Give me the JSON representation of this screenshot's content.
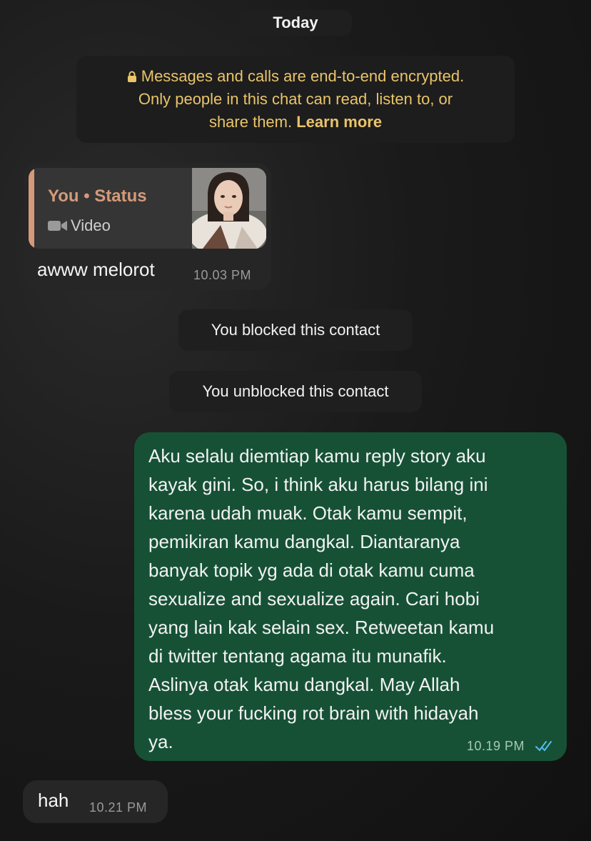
{
  "date_separator": "Today",
  "encryption_notice": {
    "text": "Messages and calls are end-to-end encrypted. Only people in this chat can read, listen to, or share them.",
    "line1": "Messages and calls are end-to-end encrypted.",
    "line2": "Only people in this chat can read, listen to, or",
    "line3": "share them.",
    "learn_more": "Learn more",
    "icon": "lock-icon"
  },
  "messages": [
    {
      "direction": "incoming",
      "quoted": {
        "title": "You • Status",
        "type_label": "Video",
        "icon": "video-icon"
      },
      "text": "awww melorot",
      "time": "10.03 PM"
    },
    {
      "system": "You blocked this contact"
    },
    {
      "system": "You unblocked this contact"
    },
    {
      "direction": "outgoing",
      "text": "Aku selalu diemtiap kamu reply story aku\nkayak gini. So, i think aku harus bilang ini\nkarena udah muak. Otak kamu sempit,\npemikiran kamu dangkal. Diantaranya\nbanyak topik yg ada di otak kamu cuma\nsexualize and sexualize again. Cari hobi\nyang lain kak selain sex. Retweetan kamu\ndi twitter tentang agama itu munafik.\nAslinya otak kamu dangkal. May Allah\nbless your fucking rot brain with hidayah\nya.",
      "time": "10.19 PM",
      "status_icon": "double-check-icon",
      "status_color": "#53bdeb"
    },
    {
      "direction": "incoming",
      "text": "hah",
      "time": "10.21 PM"
    }
  ],
  "colors": {
    "outgoing_bubble": "#165136",
    "incoming_bubble": "#262626",
    "notice_text": "#e9c46a",
    "quote_accent": "#d49a7a"
  }
}
